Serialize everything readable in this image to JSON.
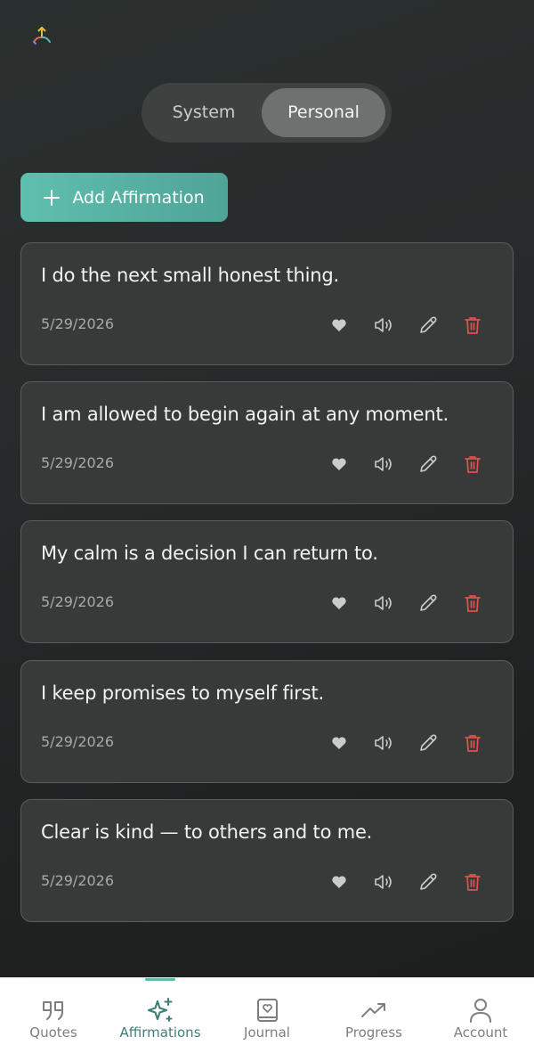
{
  "segment": {
    "system_label": "System",
    "personal_label": "Personal",
    "selected": "Personal"
  },
  "add_button": {
    "label": "Add Affirmation",
    "accent": "#5fbfaf"
  },
  "affirmations": [
    {
      "text": "I do the next small honest thing.",
      "date": "5/29/2026"
    },
    {
      "text": "I am allowed to begin again at any moment.",
      "date": "5/29/2026"
    },
    {
      "text": "My calm is a decision I can return to.",
      "date": "5/29/2026"
    },
    {
      "text": "I keep promises to myself first.",
      "date": "5/29/2026"
    },
    {
      "text": "Clear is kind — to others and to me.",
      "date": "5/29/2026"
    }
  ],
  "card_actions": [
    "heart-icon",
    "speaker-icon",
    "pencil-icon",
    "trash-icon"
  ],
  "colors": {
    "delete": "#e0524c",
    "action_icon": "#c9cccb",
    "active_nav": "#3e7f76"
  },
  "nav": {
    "items": [
      {
        "label": "Quotes",
        "icon": "quote-icon"
      },
      {
        "label": "Affirmations",
        "icon": "sparkle-icon",
        "active": true
      },
      {
        "label": "Journal",
        "icon": "journal-icon"
      },
      {
        "label": "Progress",
        "icon": "trend-up-icon"
      },
      {
        "label": "Account",
        "icon": "user-icon"
      }
    ]
  }
}
